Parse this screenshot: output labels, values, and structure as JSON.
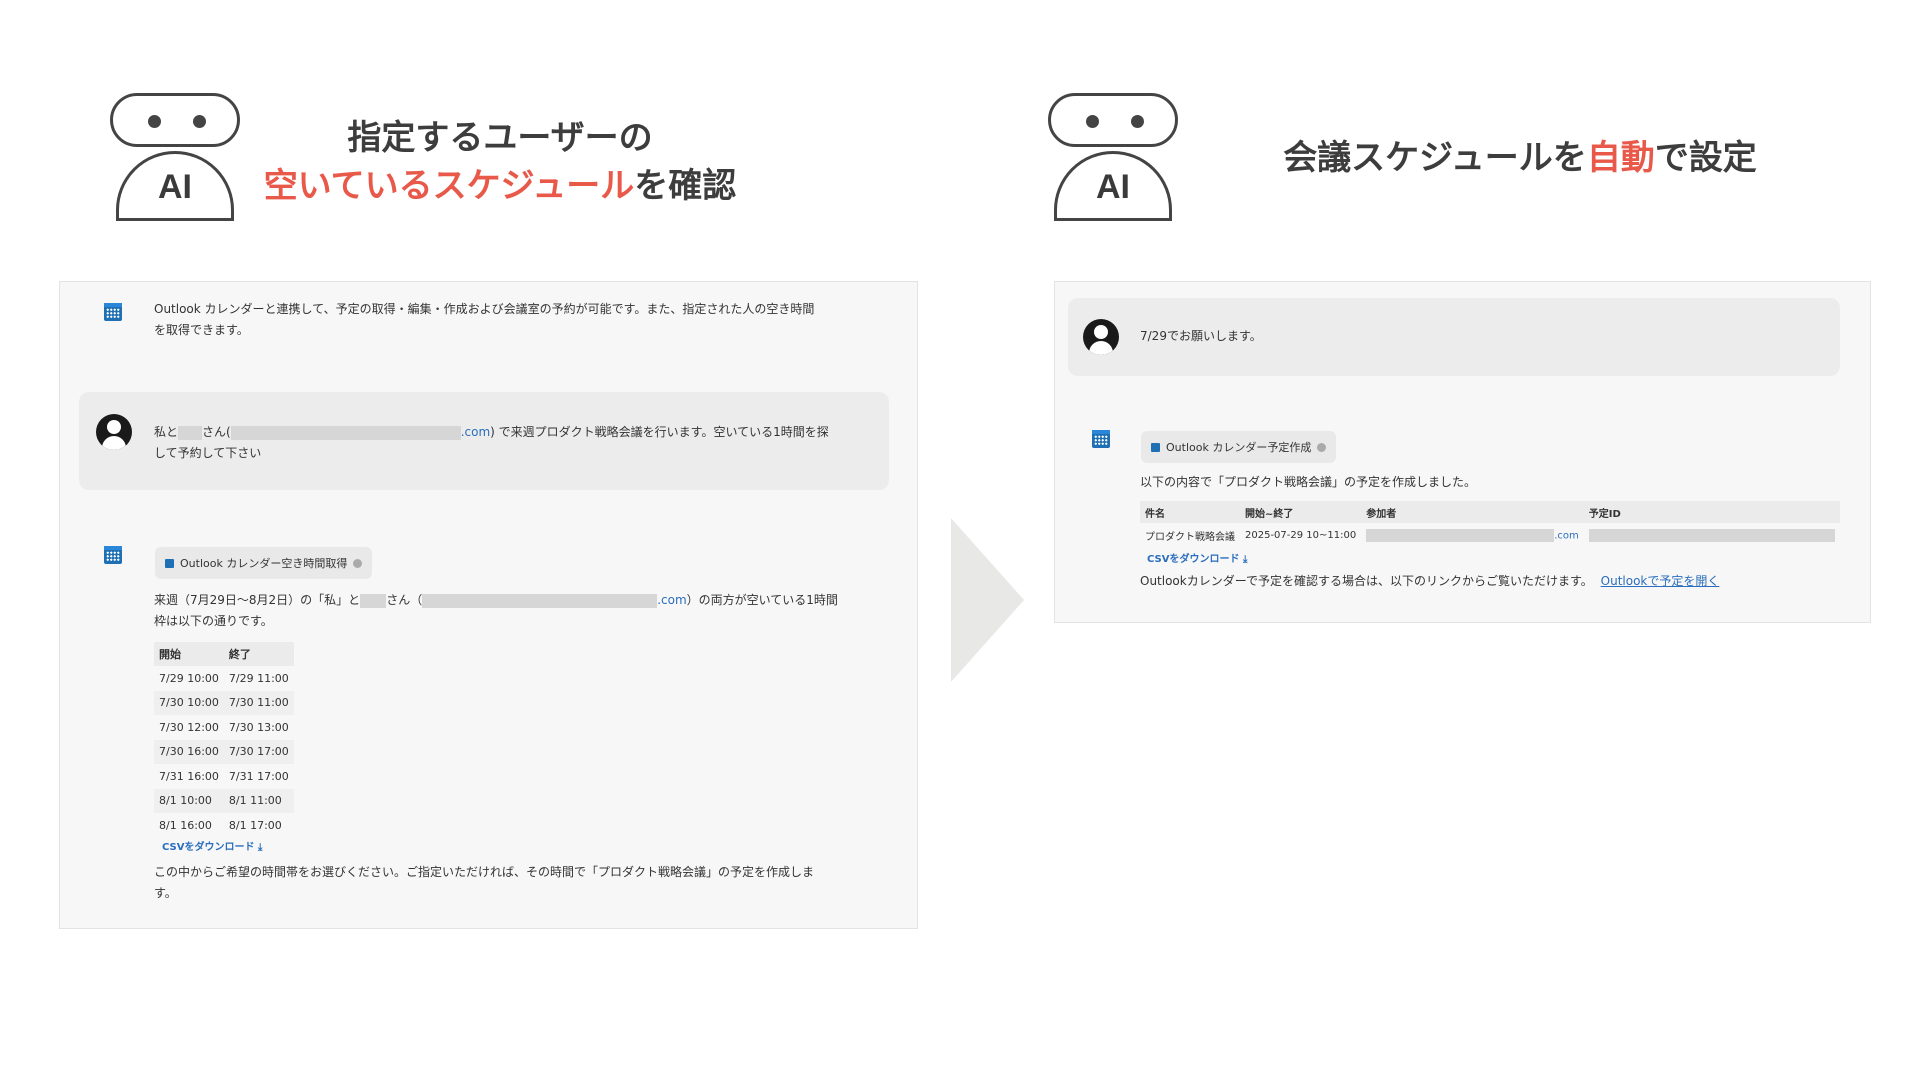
{
  "left": {
    "robot_label": "AI",
    "heading_line1": "指定するユーザーの",
    "heading_hl": "空いているスケジュール",
    "heading_tail": "を確認",
    "intro_line1": "Outlook カレンダーと連携して、予定の取得・編集・作成および会議室の予約が可能です。また、指定された人の空き時間",
    "intro_line2": "を取得できます。",
    "user_msg_a": "私と",
    "user_msg_b": "さん(",
    "user_msg_com": ".com",
    "user_msg_c": ") で来週プロダクト戦略会議を行います。空いている1時間を探",
    "user_msg_line2": "して予約して下さい",
    "tool_chip": "Outlook カレンダー空き時間取得",
    "result_a": "来週（7月29日〜8月2日）の「私」と",
    "result_b": "さん（",
    "result_com": ".com",
    "result_c": "）の両方が空いている1時間",
    "result_line2": "枠は以下の通りです。",
    "table_headers": [
      "開始",
      "終了"
    ],
    "table_rows": [
      [
        "7/29 10:00",
        "7/29 11:00"
      ],
      [
        "7/30 10:00",
        "7/30 11:00"
      ],
      [
        "7/30 12:00",
        "7/30 13:00"
      ],
      [
        "7/30 16:00",
        "7/30 17:00"
      ],
      [
        "7/31 16:00",
        "7/31 17:00"
      ],
      [
        "8/1 10:00",
        "8/1 11:00"
      ],
      [
        "8/1 16:00",
        "8/1 17:00"
      ]
    ],
    "csv_download": "CSVをダウンロード ⤓",
    "closing_line1": "この中からご希望の時間帯をお選びください。ご指定いただければ、その時間で「プロダクト戦略会議」の予定を作成しま",
    "closing_line2": "す。"
  },
  "right": {
    "robot_label": "AI",
    "heading_a": "会議スケジュールを",
    "heading_hl": "自動",
    "heading_b": "で設定",
    "user_msg": "7/29でお願いします。",
    "tool_chip": "Outlook カレンダー予定作成",
    "created_msg": "以下の内容で「プロダクト戦略会議」の予定を作成しました。",
    "table_headers": [
      "件名",
      "開始~終了",
      "参加者",
      "予定ID"
    ],
    "row_subject": "プロダクト戦略会議",
    "row_time": "2025-07-29 10~11:00",
    "row_com": ".com",
    "csv_download": "CSVをダウンロード ⤓",
    "footer_text": "Outlookカレンダーで予定を確認する場合は、以下のリンクからご覧いただけます。",
    "footer_link": "Outlookで予定を開く"
  },
  "colors": {
    "accent": "#e8594a",
    "link": "#2a6ebd",
    "calendar": "#1f6fb4"
  }
}
